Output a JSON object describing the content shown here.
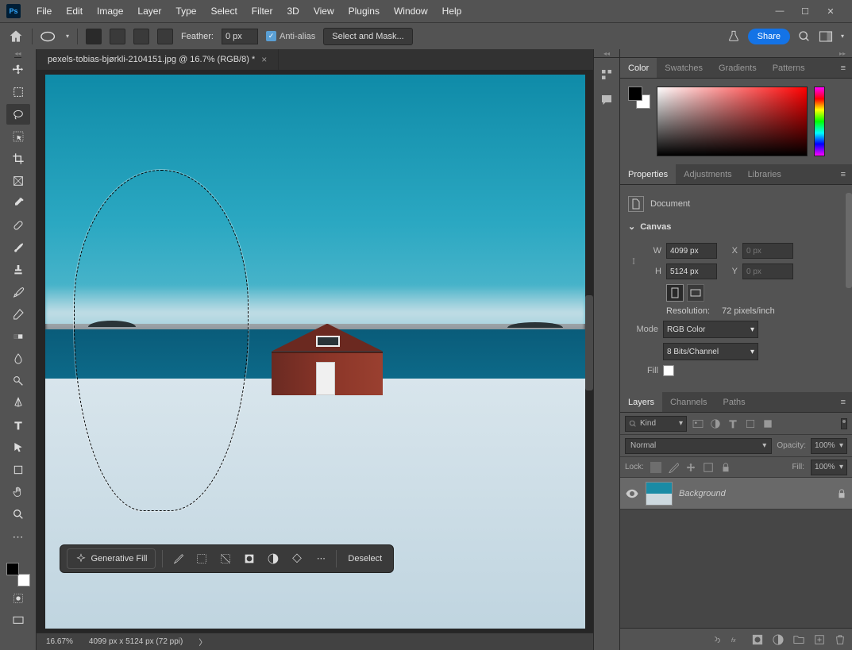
{
  "menubar": [
    "File",
    "Edit",
    "Image",
    "Layer",
    "Type",
    "Select",
    "Filter",
    "3D",
    "View",
    "Plugins",
    "Window",
    "Help"
  ],
  "optbar": {
    "feather_label": "Feather:",
    "feather_value": "0 px",
    "antialias_label": "Anti-alias",
    "select_mask": "Select and Mask...",
    "share": "Share"
  },
  "doc_tab": {
    "title": "pexels-tobias-bjørkli-2104151.jpg @ 16.7% (RGB/8) *"
  },
  "context_bar": {
    "gen_fill": "Generative Fill",
    "deselect": "Deselect"
  },
  "status": {
    "zoom": "16.67%",
    "dims": "4099 px x 5124 px (72 ppi)"
  },
  "color_tabs": [
    "Color",
    "Swatches",
    "Gradients",
    "Patterns"
  ],
  "props_tabs": [
    "Properties",
    "Adjustments",
    "Libraries"
  ],
  "props": {
    "doc_label": "Document",
    "canvas_label": "Canvas",
    "w_label": "W",
    "w_value": "4099 px",
    "h_label": "H",
    "h_value": "5124 px",
    "x_label": "X",
    "x_value": "0 px",
    "y_label": "Y",
    "y_value": "0 px",
    "res_label": "Resolution:",
    "res_value": "72 pixels/inch",
    "mode_label": "Mode",
    "mode_value": "RGB Color",
    "bits_value": "8 Bits/Channel",
    "fill_label": "Fill"
  },
  "layers_tabs": [
    "Layers",
    "Channels",
    "Paths"
  ],
  "layers": {
    "kind": "Kind",
    "blend": "Normal",
    "opacity_label": "Opacity:",
    "opacity_value": "100%",
    "lock_label": "Lock:",
    "fill_label": "Fill:",
    "fill_value": "100%",
    "layer_name": "Background"
  }
}
